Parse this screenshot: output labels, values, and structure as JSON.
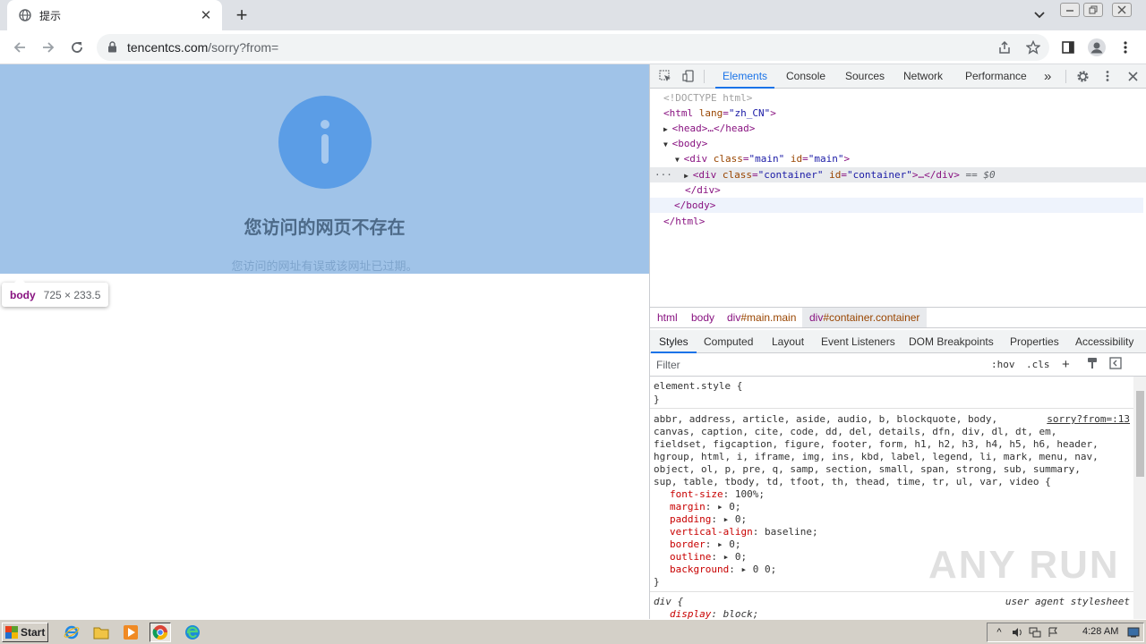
{
  "browser": {
    "tab": {
      "title": "提示",
      "close": "✕"
    },
    "new_tab": "+",
    "url_domain": "tencentcs.com",
    "url_path": "/sorry?from="
  },
  "page": {
    "title": "您访问的网页不存在",
    "subtitle": "您访问的网址有误或该网址已过期。",
    "tooltip_tag": "body",
    "tooltip_dims": "725 × 233.5",
    "highlight_color": "#a0c3e8",
    "icon_color": "#5b9de6"
  },
  "devtools": {
    "tabs": [
      "Elements",
      "Console",
      "Sources",
      "Network",
      "Performance"
    ],
    "more": "»",
    "dom": {
      "doctype": "<!DOCTYPE html>",
      "html_open_tag": "<html ",
      "html_attr": "lang",
      "html_val": "\"zh_CN\"",
      "head": "<head>…</head>",
      "body_open": "<body>",
      "div_main_tag": "<div ",
      "div_main_attr1": "class",
      "div_main_val1": "\"main\"",
      "div_main_attr2": "id",
      "div_main_val2": "\"main\"",
      "div_cont_attr1": "class",
      "div_cont_val1": "\"container\"",
      "div_cont_attr2": "id",
      "div_cont_val2": "\"container\"",
      "div_cont_end": ">…</div>",
      "eq": "== $0",
      "div_close": "</div>",
      "body_close": "</body>",
      "html_close": "</html>"
    },
    "breadcrumbs": [
      {
        "tag": "html",
        "rest": ""
      },
      {
        "tag": "body",
        "rest": ""
      },
      {
        "tag": "div",
        "rest": "#main.main"
      },
      {
        "tag": "div",
        "rest": "#container.container"
      }
    ],
    "subtabs": [
      "Styles",
      "Computed",
      "Layout",
      "Event Listeners",
      "DOM Breakpoints",
      "Properties",
      "Accessibility"
    ],
    "filter_placeholder": "Filter",
    "hov": ":hov",
    "cls": ".cls",
    "styles": {
      "element_style": "element.style {",
      "close_brace": "}",
      "reset_selector_lines": [
        "abbr, address, article, aside, audio, b, blockquote, body,",
        "canvas, caption, cite, code, dd, del, details, dfn, div, dl, dt, em,",
        "fieldset, figcaption, figure, footer, form, h1, h2, h3, h4, h5, h6, header,",
        "hgroup, html, i, iframe, img, ins, kbd, label, legend, li, mark, menu, nav,",
        "object, ol, p, pre, q, samp, section, small, span, strong, sub, summary,",
        "sup, table, tbody, td, tfoot, th, thead, time, tr, ul, var, video {"
      ],
      "reset_source": "sorry?from=:13",
      "reset_props": [
        {
          "name": "font-size",
          "value": ": 100%;"
        },
        {
          "name": "margin",
          "value": ": ▸ 0;"
        },
        {
          "name": "padding",
          "value": ": ▸ 0;"
        },
        {
          "name": "vertical-align",
          "value": ": baseline;"
        },
        {
          "name": "border",
          "value": ": ▸ 0;"
        },
        {
          "name": "outline",
          "value": ": ▸ 0;"
        },
        {
          "name": "background",
          "value": ": ▸ 0 0;"
        }
      ],
      "div_selector": "div {",
      "div_source": "user agent stylesheet",
      "div_prop": "display",
      "div_val": ": block;"
    },
    "watermark": "ANY RUN"
  },
  "taskbar": {
    "start": "Start",
    "clock": "4:28 AM"
  }
}
